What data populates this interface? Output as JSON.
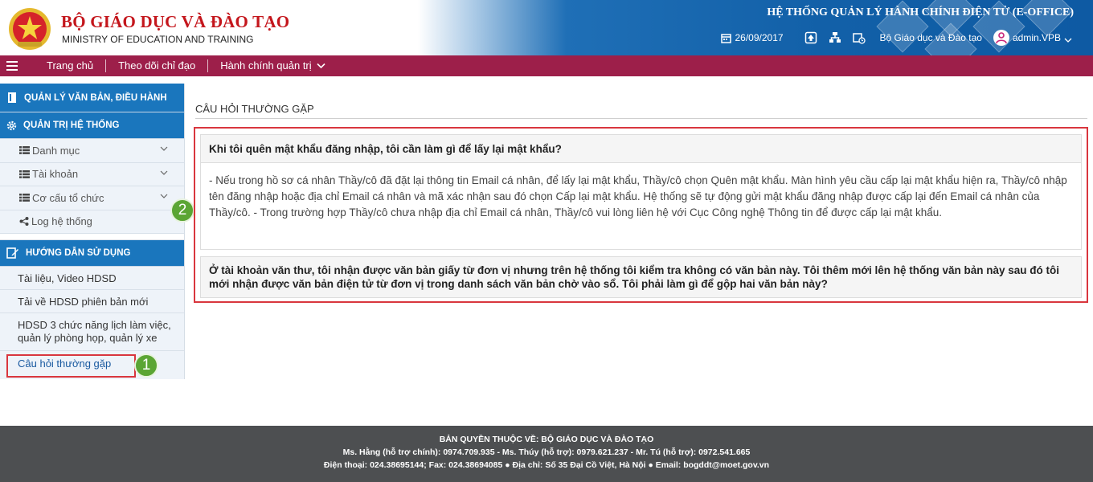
{
  "header": {
    "org_name": "BỘ GIÁO DỤC VÀ ĐÀO TẠO",
    "org_sub": "MINISTRY OF EDUCATION AND TRAINING",
    "system_title": "HỆ THỐNG QUẢN LÝ HÀNH CHÍNH ĐIỆN TỬ (E-OFFICE)",
    "date": "26/09/2017",
    "unit": "Bộ Giáo dục và Đào tạo",
    "user": "admin.VPB",
    "icons": [
      "calendar-icon",
      "upload-icon",
      "sitemap-icon",
      "calendar-clock-icon",
      "user-icon",
      "chevron-down-icon"
    ]
  },
  "nav": {
    "items": [
      {
        "label": "Trang chủ"
      },
      {
        "label": "Theo dõi chỉ đạo"
      },
      {
        "label": "Hành chính quản trị"
      }
    ]
  },
  "sidebar": {
    "section1": "QUẢN LÝ VĂN BẢN, ĐIỀU HÀNH",
    "section2": "QUẢN TRỊ HỆ THỐNG",
    "admin_items": [
      {
        "label": "Danh mục"
      },
      {
        "label": "Tài khoản"
      },
      {
        "label": "Cơ cấu tổ chức"
      },
      {
        "label": "Log hệ thống"
      }
    ],
    "section3": "HƯỚNG DẪN SỬ DỤNG",
    "guide_items": [
      {
        "label": "Tài liệu, Video HDSD"
      },
      {
        "label": "Tải về HDSD phiên bản mới"
      },
      {
        "label": "HDSD 3 chức năng lịch làm việc, quản lý phòng họp, quản lý xe"
      },
      {
        "label": "Câu hỏi thường gặp"
      }
    ]
  },
  "annotations": {
    "step1": "1",
    "step2": "2",
    "highlight_color": "#d9363e",
    "badge_color": "#5ba534"
  },
  "content": {
    "title": "CÂU HỎI THƯỜNG GẶP",
    "q1": "Khi tôi quên mật khẩu đăng nhập, tôi cần làm gì để lấy lại mật khẩu?",
    "a1": "- Nếu trong hồ sơ cá nhân Thầy/cô đã đặt lại thông tin Email cá nhân, để lấy lại mật khẩu, Thầy/cô chọn Quên mật khẩu. Màn hình yêu cầu cấp lại mật khẩu hiện ra, Thầy/cô nhập tên đăng nhập hoặc địa chỉ Email cá nhân và mã xác nhận sau đó chọn Cấp lại mật khẩu. Hệ thống sẽ tự động gửi mật khẩu đăng nhập được cấp lại đến Email cá nhân của Thầy/cô. - Trong trường hợp Thầy/cô chưa nhập địa chỉ Email cá nhân, Thầy/cô vui lòng liên hệ với Cục Công nghệ Thông tin để được cấp lại mật khẩu.",
    "q2": "Ở tài khoản văn thư, tôi nhận được văn bản giấy từ đơn vị nhưng trên hệ thống tôi kiểm tra không có văn bản này. Tôi thêm mới lên hệ thống văn bản này sau đó tôi mới nhận được văn bản điện tử từ đơn vị trong danh sách văn bản chờ vào sổ. Tôi phải làm gì để gộp hai văn bản này?"
  },
  "footer": {
    "line1": "BẢN QUYỀN THUỘC VỀ: BỘ GIÁO DỤC VÀ ĐÀO TẠO",
    "line2": "Ms. Hằng (hỗ trợ chính): 0974.709.935 - Ms. Thúy (hỗ trợ): 0979.621.237 - Mr. Tú (hỗ trợ): 0972.541.665",
    "line3": "Điện thoại: 024.38695144; Fax: 024.38694085 ● Địa chỉ: Số 35 Đại Cồ Việt, Hà Nội ● Email: bogddt@moet.gov.vn"
  }
}
